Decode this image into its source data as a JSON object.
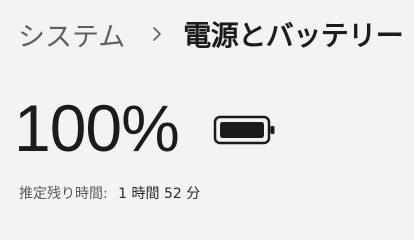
{
  "breadcrumb": {
    "parent": "システム",
    "separator_icon": "chevron-right-icon",
    "current": "電源とバッテリー"
  },
  "battery": {
    "percent_label": "100%",
    "level_fraction": 1.0,
    "icon": "battery-full-icon",
    "estimate_label": "推定残り時間:",
    "estimate_value": "1 時間 52 分"
  },
  "colors": {
    "background": "#f3f3f3",
    "text_primary": "#1b1b1b",
    "text_secondary": "#5f5f5f",
    "battery_fill": "#1b1b1b"
  }
}
